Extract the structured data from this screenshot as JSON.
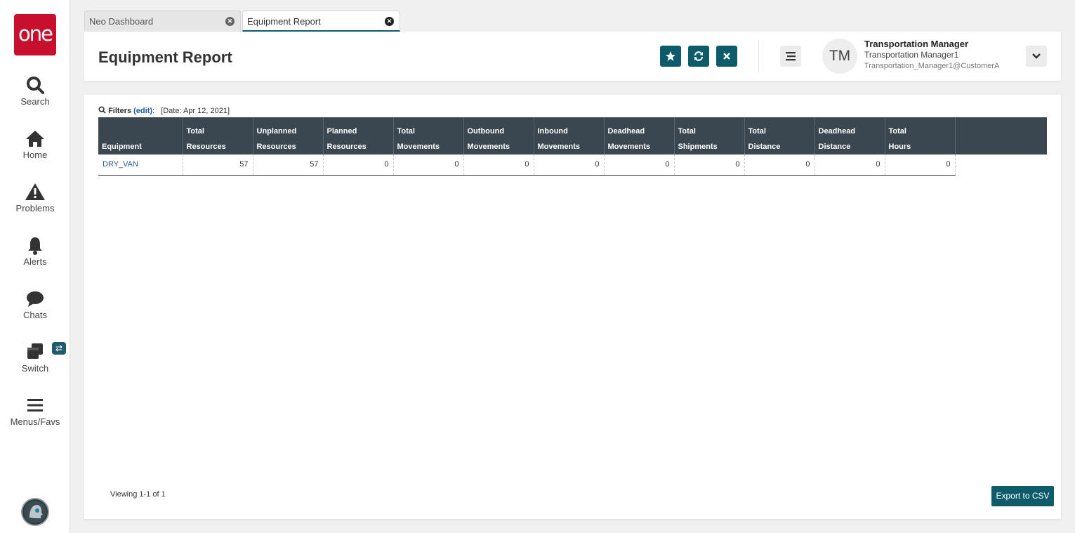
{
  "brand": {
    "logo_text": "one",
    "logo_color": "#c8102e"
  },
  "sidebar": {
    "items": [
      {
        "label": "Search",
        "icon": "search-icon"
      },
      {
        "label": "Home",
        "icon": "home-icon"
      },
      {
        "label": "Problems",
        "icon": "warning-icon"
      },
      {
        "label": "Alerts",
        "icon": "bell-icon"
      },
      {
        "label": "Chats",
        "icon": "chat-bubble-icon"
      },
      {
        "label": "Switch",
        "icon": "switch-windows-icon",
        "badge_icon": "swap-arrows-icon"
      },
      {
        "label": "Menus/Favs",
        "icon": "hamburger-icon"
      }
    ]
  },
  "tabs": [
    {
      "label": "Neo Dashboard",
      "active": false
    },
    {
      "label": "Equipment Report",
      "active": true
    }
  ],
  "header": {
    "title": "Equipment Report",
    "actions": [
      "star-icon",
      "refresh-icon",
      "close-icon"
    ],
    "user": {
      "initials": "TM",
      "role": "Transportation Manager",
      "name": "Transportation Manager1",
      "email": "Transportation_Manager1@CustomerA"
    }
  },
  "filters": {
    "label": "Filters",
    "edit_text": "(edit)",
    "colon": ":",
    "value": "[Date: Apr 12, 2021]"
  },
  "table": {
    "columns": [
      {
        "line1": "",
        "line2": "Equipment"
      },
      {
        "line1": "Total",
        "line2": "Resources"
      },
      {
        "line1": "Unplanned",
        "line2": "Resources"
      },
      {
        "line1": "Planned",
        "line2": "Resources"
      },
      {
        "line1": "Total",
        "line2": "Movements"
      },
      {
        "line1": "Outbound",
        "line2": "Movements"
      },
      {
        "line1": "Inbound",
        "line2": "Movements"
      },
      {
        "line1": "Deadhead",
        "line2": "Movements"
      },
      {
        "line1": "Total",
        "line2": "Shipments"
      },
      {
        "line1": "Total",
        "line2": "Distance"
      },
      {
        "line1": "Deadhead",
        "line2": "Distance"
      },
      {
        "line1": "Total",
        "line2": "Hours"
      }
    ],
    "rows": [
      [
        "DRY_VAN",
        "57",
        "57",
        "0",
        "0",
        "0",
        "0",
        "0",
        "0",
        "0",
        "0",
        "0"
      ]
    ]
  },
  "footer": {
    "viewing": "Viewing 1-1 of 1",
    "export_label": "Export to CSV"
  },
  "colors": {
    "accent": "#0d5b6b",
    "table_header": "#3a4750",
    "link": "#1f5a9a"
  }
}
